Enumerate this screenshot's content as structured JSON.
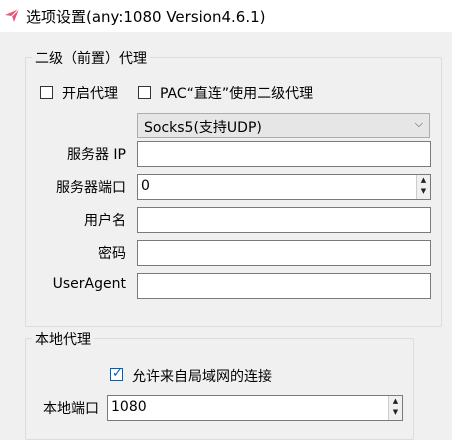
{
  "window": {
    "title": "选项设置(any:1080 Version4.6.1)",
    "icon": "airplane-app-icon",
    "accent": "#e8567a"
  },
  "secondary_proxy": {
    "legend": "二级（前置）代理",
    "enable_proxy": {
      "label": "开启代理",
      "checked": false
    },
    "pac_direct_use_secondary": {
      "label": "PAC“直连”使用二级代理",
      "checked": false
    },
    "protocol_select": {
      "value": "Socks5(支持UDP)"
    },
    "server_ip": {
      "label": "服务器 IP",
      "value": ""
    },
    "server_port": {
      "label": "服务器端口",
      "value": "0"
    },
    "username": {
      "label": "用户名",
      "value": ""
    },
    "password": {
      "label": "密码",
      "value": ""
    },
    "user_agent": {
      "label": "UserAgent",
      "value": ""
    }
  },
  "local_proxy": {
    "legend": "本地代理",
    "allow_lan": {
      "label": "允许来自局域网的连接",
      "checked": true
    },
    "local_port": {
      "label": "本地端口",
      "value": "1080"
    }
  }
}
